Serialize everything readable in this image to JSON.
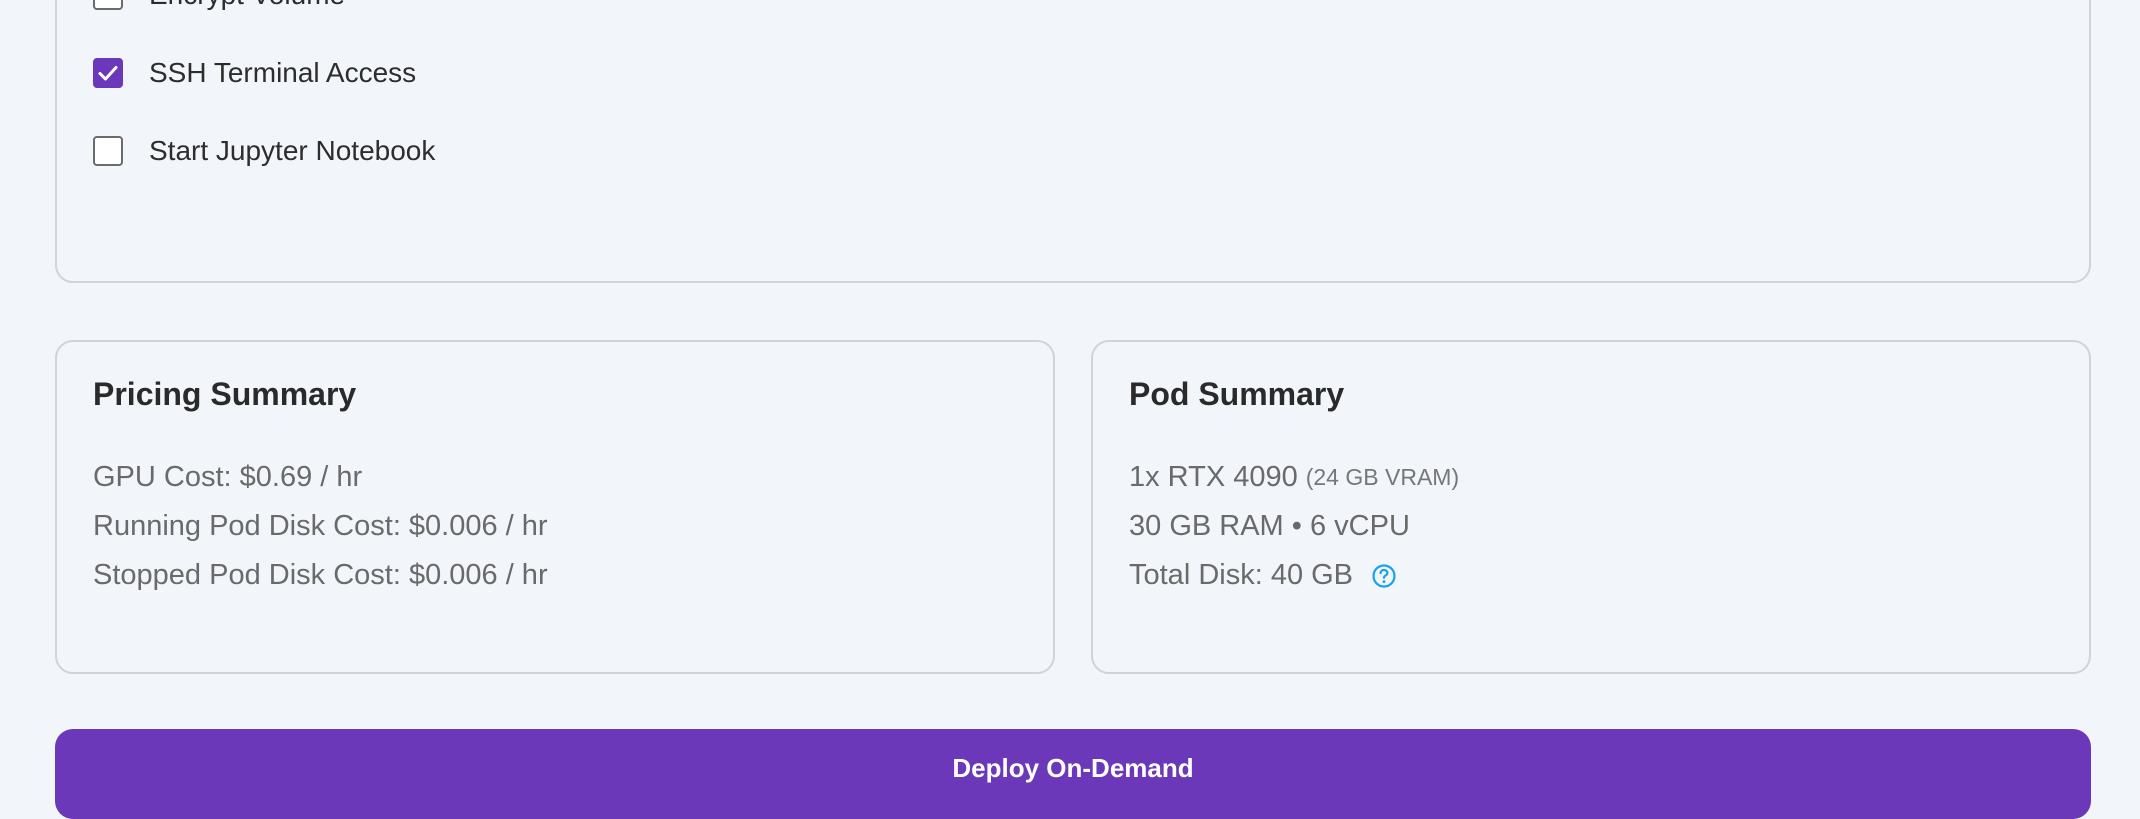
{
  "options": [
    {
      "label": "Encrypt Volume",
      "checked": false
    },
    {
      "label": "SSH Terminal Access",
      "checked": true
    },
    {
      "label": "Start Jupyter Notebook",
      "checked": false
    }
  ],
  "pricing": {
    "title": "Pricing Summary",
    "gpu_cost": "GPU Cost: $0.69 / hr",
    "running_disk_cost": "Running Pod Disk Cost: $0.006 / hr",
    "stopped_disk_cost": "Stopped Pod Disk Cost: $0.006 / hr"
  },
  "pod": {
    "title": "Pod Summary",
    "gpu": "1x RTX 4090",
    "vram": "(24 GB VRAM)",
    "resources": "30 GB RAM • 6 vCPU",
    "total_disk": "Total Disk: 40 GB",
    "help_icon": "question-circle-icon"
  },
  "deploy": {
    "label": "Deploy On-Demand"
  },
  "colors": {
    "accent": "#6a38b8",
    "checkbox_checked": "#6b38bc",
    "help_icon": "#1aa3e8",
    "background": "#f2f5fa"
  }
}
